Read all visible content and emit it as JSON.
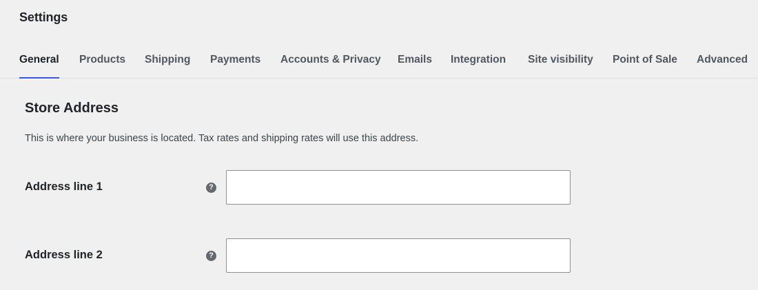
{
  "page": {
    "title": "Settings"
  },
  "tabs": [
    {
      "label": "General",
      "active": true
    },
    {
      "label": "Products",
      "active": false
    },
    {
      "label": "Shipping",
      "active": false
    },
    {
      "label": "Payments",
      "active": false
    },
    {
      "label": "Accounts & Privacy",
      "active": false
    },
    {
      "label": "Emails",
      "active": false
    },
    {
      "label": "Integration",
      "active": false
    },
    {
      "label": "Site visibility",
      "active": false
    },
    {
      "label": "Point of Sale",
      "active": false
    },
    {
      "label": "Advanced",
      "active": false
    }
  ],
  "section": {
    "title": "Store Address",
    "description": "This is where your business is located. Tax rates and shipping rates will use this address."
  },
  "fields": [
    {
      "label": "Address line 1",
      "help_icon": "question-mark-icon",
      "value": "",
      "placeholder": ""
    },
    {
      "label": "Address line 2",
      "help_icon": "question-mark-icon",
      "value": "",
      "placeholder": ""
    }
  ],
  "colors": {
    "background": "#f0f0f1",
    "active_tab_underline": "#3858e9",
    "help_icon": "#646970"
  }
}
